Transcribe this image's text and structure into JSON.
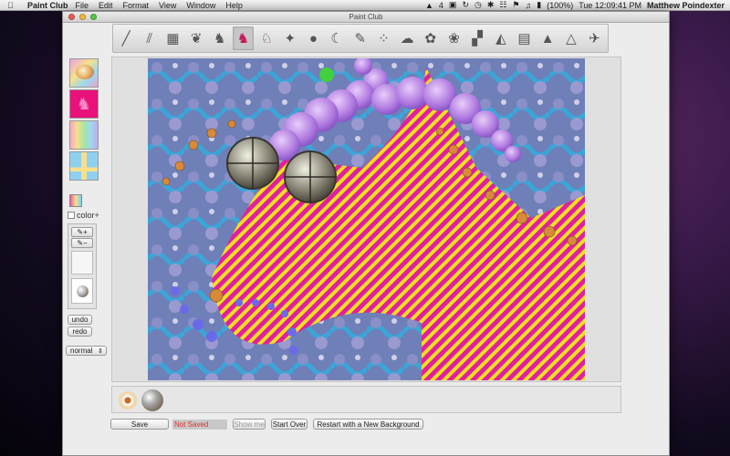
{
  "menubar": {
    "app_name": "Paint Club",
    "menus": [
      "File",
      "Edit",
      "Format",
      "View",
      "Window",
      "Help"
    ],
    "notification_count": "4",
    "battery": "(100%)",
    "datetime": "Tue 12:09:41 PM",
    "user": "Matthew Poindexter"
  },
  "window": {
    "title": "Paint Club"
  },
  "toolbar": {
    "tools": [
      {
        "icon": "brush-icon",
        "glyph": "╱"
      },
      {
        "icon": "scribble-icon",
        "glyph": "⫽"
      },
      {
        "icon": "texture-icon",
        "glyph": "▦"
      },
      {
        "icon": "leaf-icon",
        "glyph": "❦"
      },
      {
        "icon": "cat-icon",
        "glyph": "♞"
      },
      {
        "icon": "cat-pink-icon",
        "glyph": "♞"
      },
      {
        "icon": "wolf-icon",
        "glyph": "♘"
      },
      {
        "icon": "creature-icon",
        "glyph": "✦"
      },
      {
        "icon": "circle-icon",
        "glyph": "●"
      },
      {
        "icon": "claw-icon",
        "glyph": "☾"
      },
      {
        "icon": "feather-icon",
        "glyph": "✎"
      },
      {
        "icon": "dots-icon",
        "glyph": "⁘"
      },
      {
        "icon": "blob-icon",
        "glyph": "☁"
      },
      {
        "icon": "cluster-icon",
        "glyph": "✿"
      },
      {
        "icon": "spiral-icon",
        "glyph": "❀"
      },
      {
        "icon": "checker-icon",
        "glyph": "▞"
      },
      {
        "icon": "stack-icon",
        "glyph": "◭"
      },
      {
        "icon": "grid-icon",
        "glyph": "▤"
      },
      {
        "icon": "pyramid-icon",
        "glyph": "▲"
      },
      {
        "icon": "triangle-icon",
        "glyph": "△"
      },
      {
        "icon": "bird-icon",
        "glyph": "✈"
      }
    ],
    "selected_index": 5
  },
  "left_panel": {
    "color_plus_label": "color+",
    "size_plus": "✎+",
    "size_minus": "✎−",
    "undo_label": "undo",
    "redo_label": "redo",
    "mode_value": "normal"
  },
  "bottom": {
    "save_label": "Save",
    "status_text": "Not Saved",
    "show_me_label": "Show me",
    "start_over_label": "Start Over",
    "restart_label": "Restart with a New Background"
  },
  "colors": {
    "stripe_magenta": "#e020a0",
    "stripe_yellow": "#f0e020",
    "lavender": "#c08ae8",
    "canvas_blue": "#5a78c0",
    "status_red": "#e0302a"
  }
}
